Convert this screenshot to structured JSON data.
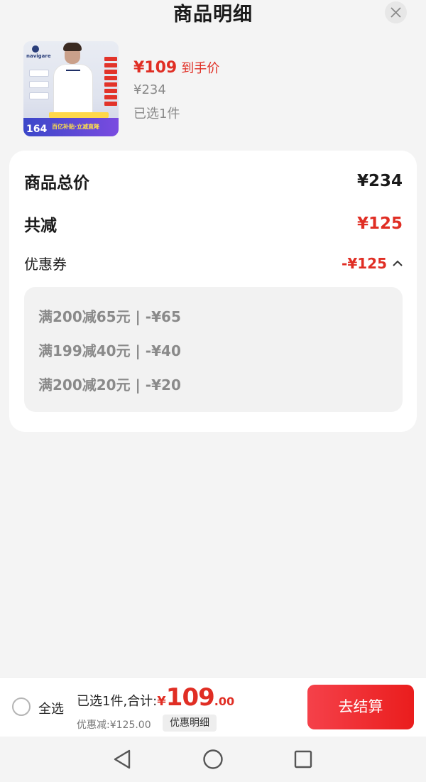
{
  "header": {
    "title": "商品明细"
  },
  "product": {
    "thumb": {
      "brand": "navigare",
      "price_badge": "164",
      "promo": "百亿补贴·立减直降"
    },
    "deal_price": "¥109",
    "deal_tag": "到手价",
    "original_price": "¥234",
    "selected": "已选1件"
  },
  "summary_card": {
    "total_label": "商品总价",
    "total_value": "¥234",
    "reduce_label": "共减",
    "reduce_value": "¥125",
    "coupon_label": "优惠券",
    "coupon_value": "-¥125",
    "coupons": [
      "满200减65元 | -¥65",
      "满199减40元 | -¥40",
      "满200减20元 | -¥20"
    ]
  },
  "bottom_bar": {
    "select_all": "全选",
    "summary_label": "已选1件,合计:",
    "currency": "¥",
    "amount_int": "109",
    "amount_dec": ".00",
    "discount": "优惠减:¥125.00",
    "detail_button": "优惠明细",
    "checkout_button": "去结算"
  },
  "colors": {
    "accent": "#e02e24",
    "checkout": "#f02a2f",
    "background": "#f4f4f4"
  },
  "nav": {
    "icons": [
      "back-triangle-icon",
      "home-circle-icon",
      "recents-square-icon"
    ]
  }
}
